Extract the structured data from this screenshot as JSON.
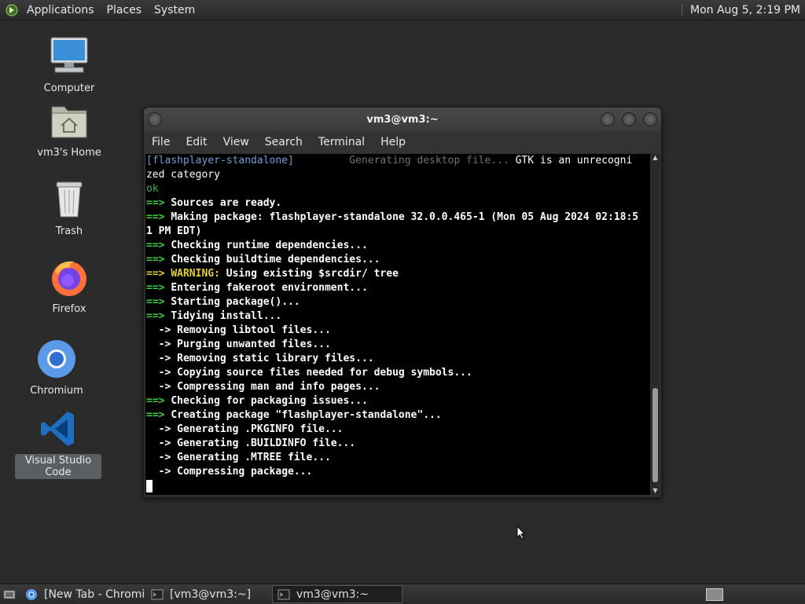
{
  "top_panel": {
    "menus": [
      "Applications",
      "Places",
      "System"
    ],
    "clock": "Mon Aug  5, 2:19 PM"
  },
  "desktop": {
    "icons": [
      {
        "label": "Computer",
        "icon": "computer-icon"
      },
      {
        "label": "vm3's Home",
        "icon": "home-folder-icon"
      },
      {
        "label": "Trash",
        "icon": "trash-icon"
      },
      {
        "label": "Firefox",
        "icon": "firefox-icon"
      },
      {
        "label": "Chromium",
        "icon": "chromium-icon"
      },
      {
        "label": "Visual Studio Code",
        "icon": "vscode-icon",
        "selected": true
      }
    ]
  },
  "terminal": {
    "title": "vm3@vm3:~",
    "menus": [
      "File",
      "Edit",
      "View",
      "Search",
      "Terminal",
      "Help"
    ],
    "lines": [
      {
        "segments": [
          {
            "text": "[flashplayer-standalone]",
            "cls": "blue"
          },
          {
            "text": "         Generating desktop file... ",
            "cls": "dim"
          },
          {
            "text": "GTK is an unrecogni",
            "cls": ""
          }
        ]
      },
      {
        "segments": [
          {
            "text": "zed category",
            "cls": ""
          }
        ]
      },
      {
        "segments": [
          {
            "text": "ok",
            "cls": "okgreen"
          }
        ]
      },
      {
        "segments": [
          {
            "text": "==> ",
            "cls": "arrow-green"
          },
          {
            "text": "Sources are ready.",
            "cls": "bold"
          }
        ]
      },
      {
        "segments": [
          {
            "text": "==> ",
            "cls": "arrow-green"
          },
          {
            "text": "Making package: flashplayer-standalone 32.0.0.465-1 (Mon 05 Aug 2024 02:18:5",
            "cls": "bold"
          }
        ]
      },
      {
        "segments": [
          {
            "text": "1 PM EDT)",
            "cls": "bold"
          }
        ]
      },
      {
        "segments": [
          {
            "text": "==> ",
            "cls": "arrow-green"
          },
          {
            "text": "Checking runtime dependencies...",
            "cls": "bold"
          }
        ]
      },
      {
        "segments": [
          {
            "text": "==> ",
            "cls": "arrow-green"
          },
          {
            "text": "Checking buildtime dependencies...",
            "cls": "bold"
          }
        ]
      },
      {
        "segments": [
          {
            "text": "==> ",
            "cls": "warn"
          },
          {
            "text": "WARNING:",
            "cls": "warn"
          },
          {
            "text": " Using existing $srcdir/ tree",
            "cls": "bold"
          }
        ]
      },
      {
        "segments": [
          {
            "text": "==> ",
            "cls": "arrow-green"
          },
          {
            "text": "Entering fakeroot environment...",
            "cls": "bold"
          }
        ]
      },
      {
        "segments": [
          {
            "text": "==> ",
            "cls": "arrow-green"
          },
          {
            "text": "Starting package()...",
            "cls": "bold"
          }
        ]
      },
      {
        "segments": [
          {
            "text": "==> ",
            "cls": "arrow-green"
          },
          {
            "text": "Tidying install...",
            "cls": "bold"
          }
        ]
      },
      {
        "segments": [
          {
            "text": "  -> ",
            "cls": "bold"
          },
          {
            "text": "Removing libtool files...",
            "cls": "bold"
          }
        ]
      },
      {
        "segments": [
          {
            "text": "  -> ",
            "cls": "bold"
          },
          {
            "text": "Purging unwanted files...",
            "cls": "bold"
          }
        ]
      },
      {
        "segments": [
          {
            "text": "  -> ",
            "cls": "bold"
          },
          {
            "text": "Removing static library files...",
            "cls": "bold"
          }
        ]
      },
      {
        "segments": [
          {
            "text": "  -> ",
            "cls": "bold"
          },
          {
            "text": "Copying source files needed for debug symbols...",
            "cls": "bold"
          }
        ]
      },
      {
        "segments": [
          {
            "text": "  -> ",
            "cls": "bold"
          },
          {
            "text": "Compressing man and info pages...",
            "cls": "bold"
          }
        ]
      },
      {
        "segments": [
          {
            "text": "==> ",
            "cls": "arrow-green"
          },
          {
            "text": "Checking for packaging issues...",
            "cls": "bold"
          }
        ]
      },
      {
        "segments": [
          {
            "text": "==> ",
            "cls": "arrow-green"
          },
          {
            "text": "Creating package \"flashplayer-standalone\"...",
            "cls": "bold"
          }
        ]
      },
      {
        "segments": [
          {
            "text": "  -> ",
            "cls": "bold"
          },
          {
            "text": "Generating .PKGINFO file...",
            "cls": "bold"
          }
        ]
      },
      {
        "segments": [
          {
            "text": "  -> ",
            "cls": "bold"
          },
          {
            "text": "Generating .BUILDINFO file...",
            "cls": "bold"
          }
        ]
      },
      {
        "segments": [
          {
            "text": "  -> ",
            "cls": "bold"
          },
          {
            "text": "Generating .MTREE file...",
            "cls": "bold"
          }
        ]
      },
      {
        "segments": [
          {
            "text": "  -> ",
            "cls": "bold"
          },
          {
            "text": "Compressing package...",
            "cls": "bold"
          }
        ]
      }
    ]
  },
  "taskbar": {
    "tasks": [
      {
        "label": "[New Tab - Chromi...",
        "icon": "chromium-icon",
        "active": false
      },
      {
        "label": "[vm3@vm3:~]",
        "icon": "terminal-icon",
        "active": false
      },
      {
        "label": "vm3@vm3:~",
        "icon": "terminal-icon",
        "active": true
      }
    ]
  },
  "colors": {
    "desktop_bg": "#2b2b2b",
    "terminal_bg": "#000000",
    "prompt_green": "#3fcf3f",
    "warning_yellow": "#e3cf3a"
  }
}
